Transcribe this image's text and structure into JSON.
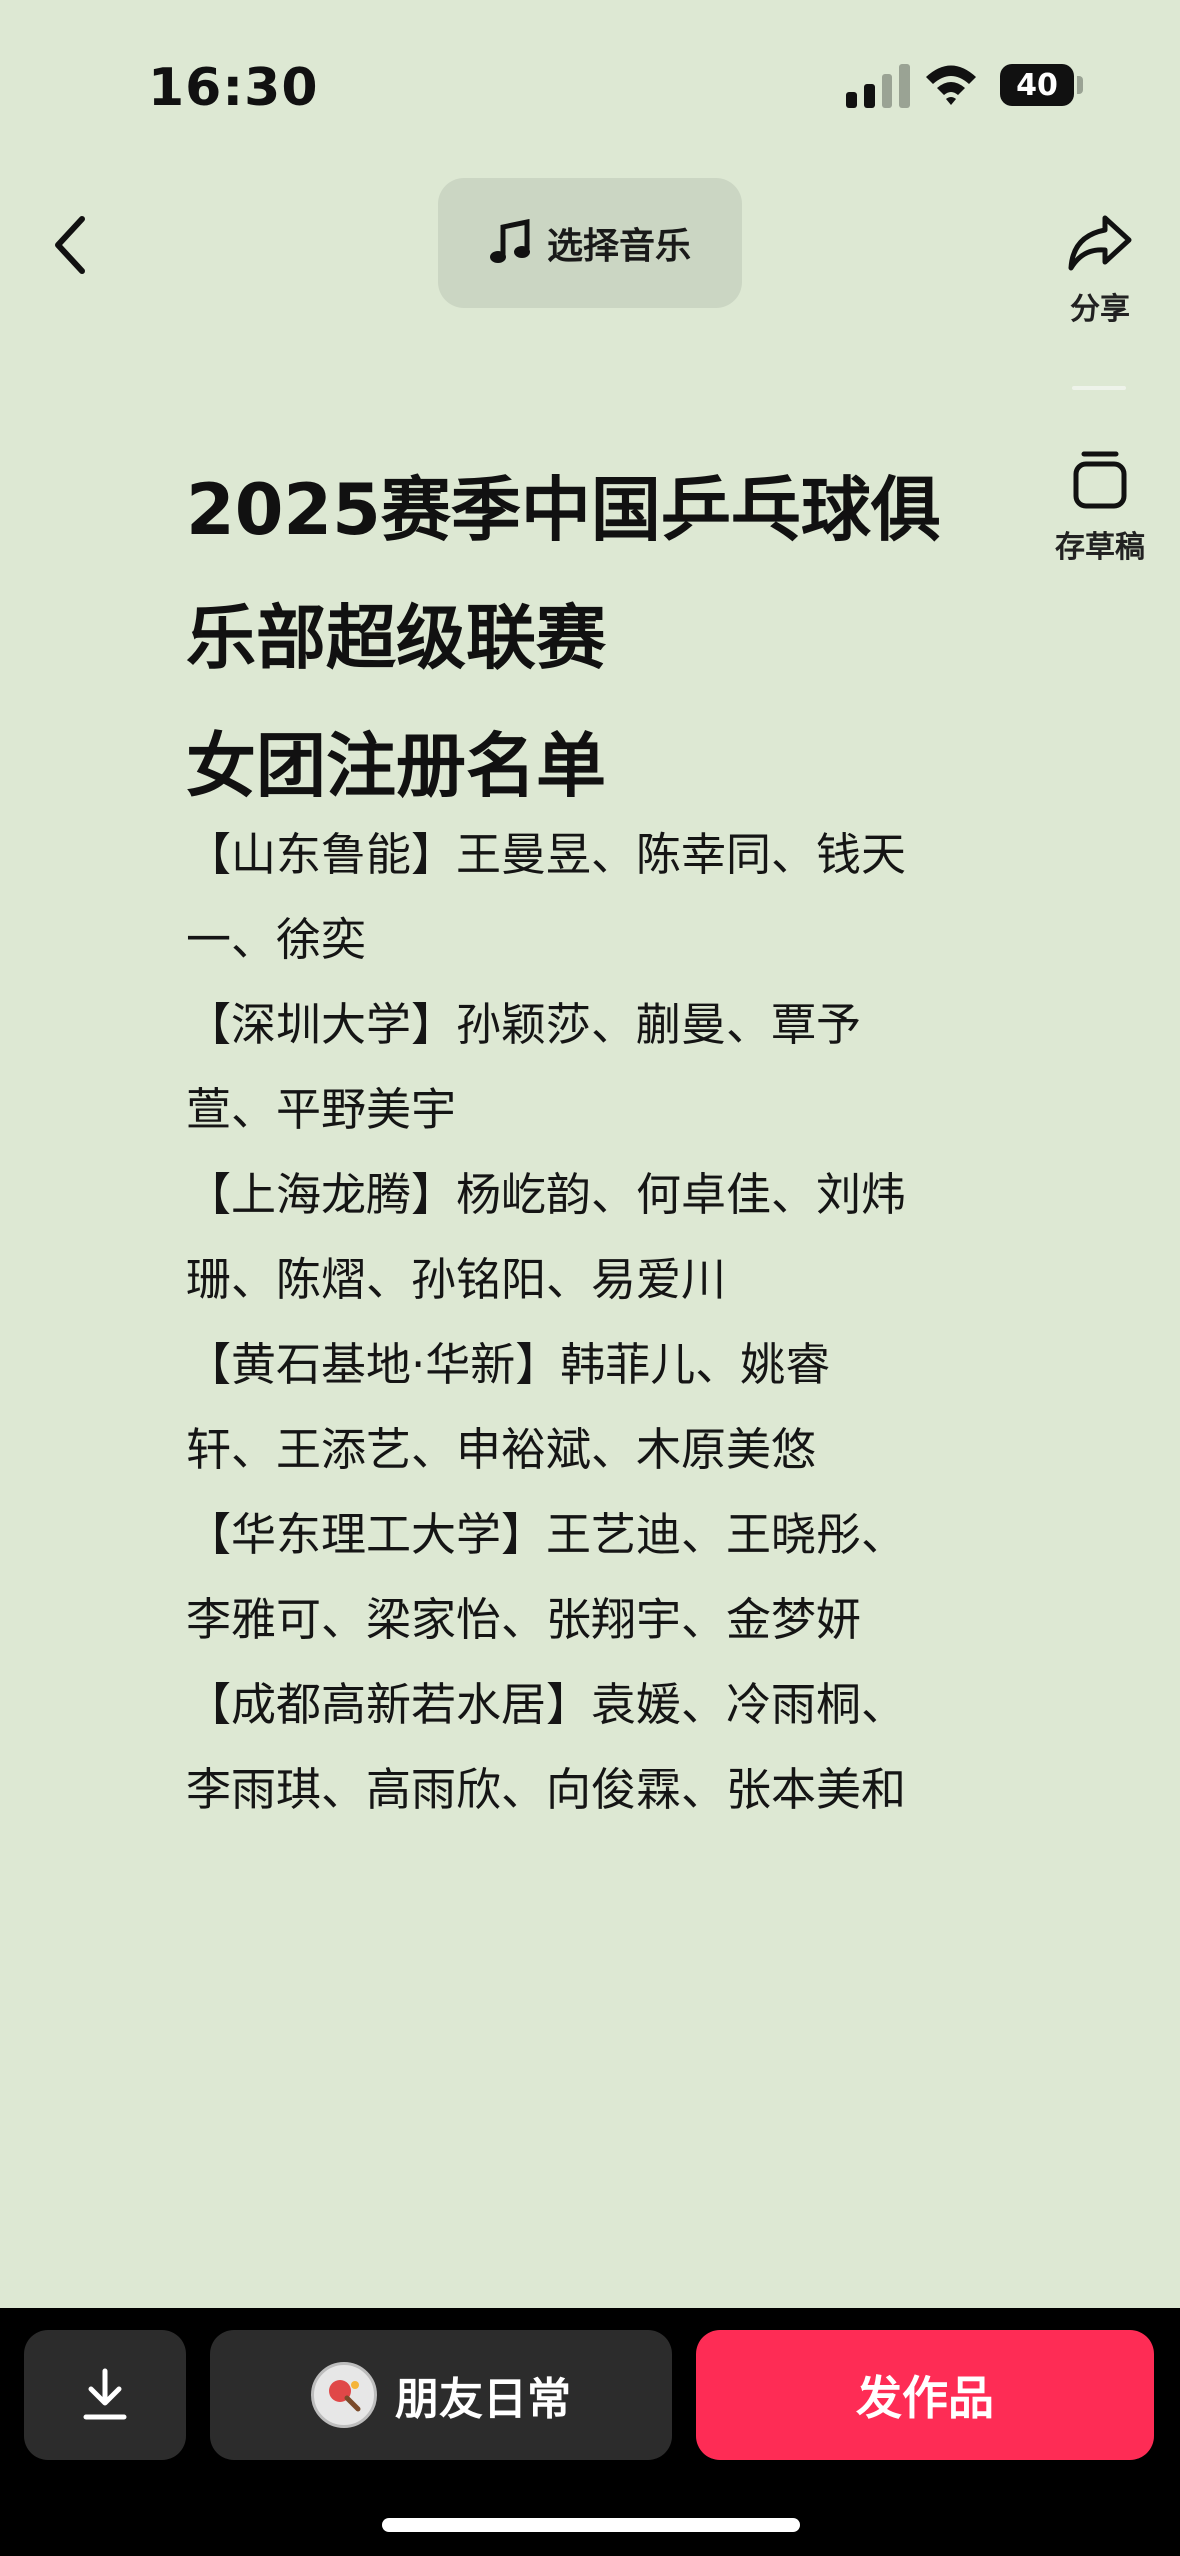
{
  "status": {
    "time": "16:30",
    "battery": "40"
  },
  "toolbar": {
    "music_label": "选择音乐",
    "share_label": "分享",
    "draft_label": "存草稿"
  },
  "content": {
    "title_lines": [
      "2025赛季中国乒乓球俱",
      "乐部超级联赛",
      "女团注册名单"
    ],
    "body_lines": [
      "【山东鲁能】王曼昱、陈幸同、钱天",
      "一、徐奕",
      "【深圳大学】孙颖莎、蒯曼、覃予",
      "萱、平野美宇",
      "【上海龙腾】杨屹韵、何卓佳、刘炜",
      "珊、陈熠、孙铭阳、易爱川",
      "【黄石基地·华新】韩菲儿、姚睿",
      "轩、王添艺、申裕斌、木原美悠",
      "【华东理工大学】王艺迪、王晓彤、",
      "李雅可、梁家怡、张翔宇、金梦妍",
      "【成都高新若水居】袁媛、冷雨桐、",
      "李雨琪、高雨欣、向俊霖、张本美和"
    ]
  },
  "bottom_bar": {
    "friends_label": "朋友日常",
    "publish_label": "发作品"
  },
  "colors": {
    "background": "#dde8d3",
    "publish": "#fe2c55"
  }
}
